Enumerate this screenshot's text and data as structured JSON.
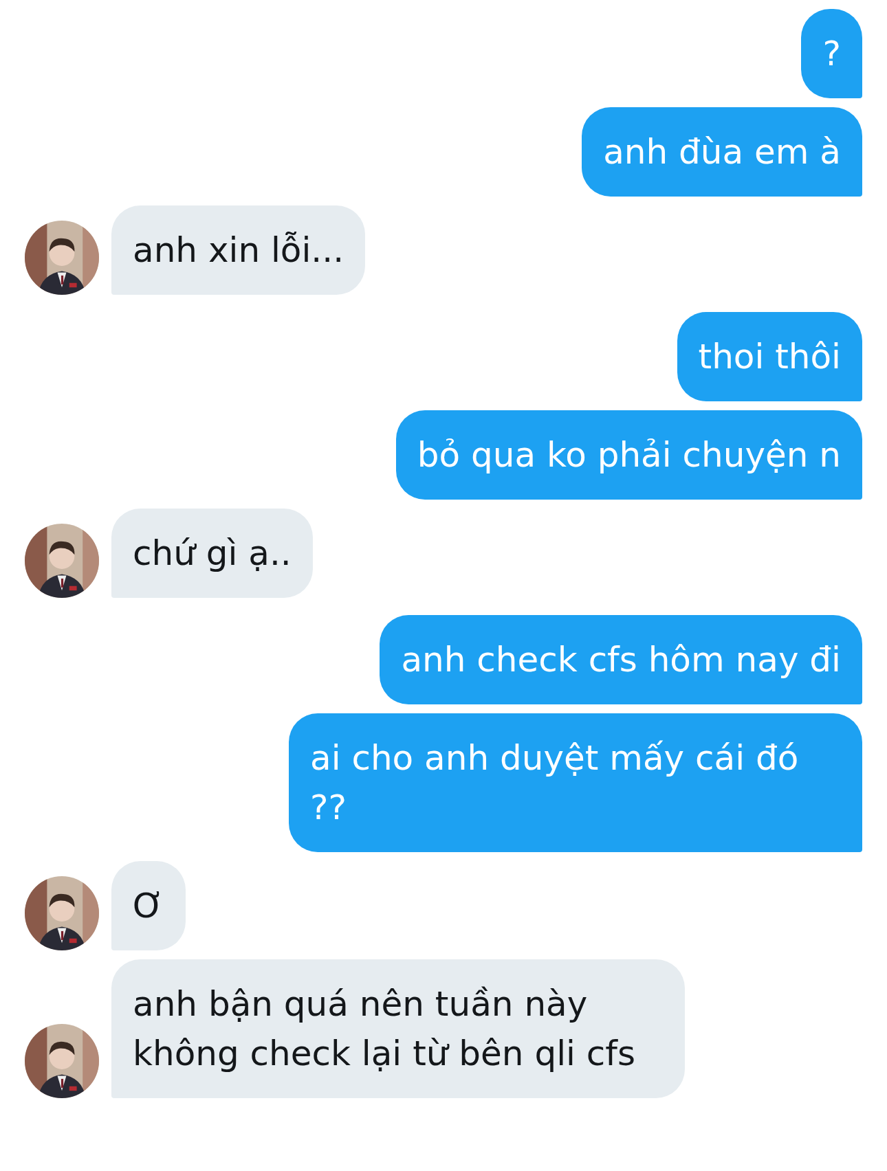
{
  "messages": [
    {
      "kind": "sent",
      "text": "?"
    },
    {
      "kind": "sent",
      "text": "anh đùa em à"
    },
    {
      "kind": "received",
      "text": "anh xin lỗi..."
    },
    {
      "kind": "sent",
      "text": "thoi thôi"
    },
    {
      "kind": "sent",
      "text": "bỏ qua ko phải chuyện n"
    },
    {
      "kind": "received",
      "text": "chứ gì ạ.."
    },
    {
      "kind": "sent",
      "text": "anh check cfs hôm nay đi"
    },
    {
      "kind": "sent",
      "text": "ai cho anh duyệt mấy cái đó ??"
    },
    {
      "kind": "received",
      "text": "Ơ"
    },
    {
      "kind": "received",
      "text": "anh bận quá nên tuần này không check lại từ bên qli cfs"
    }
  ]
}
